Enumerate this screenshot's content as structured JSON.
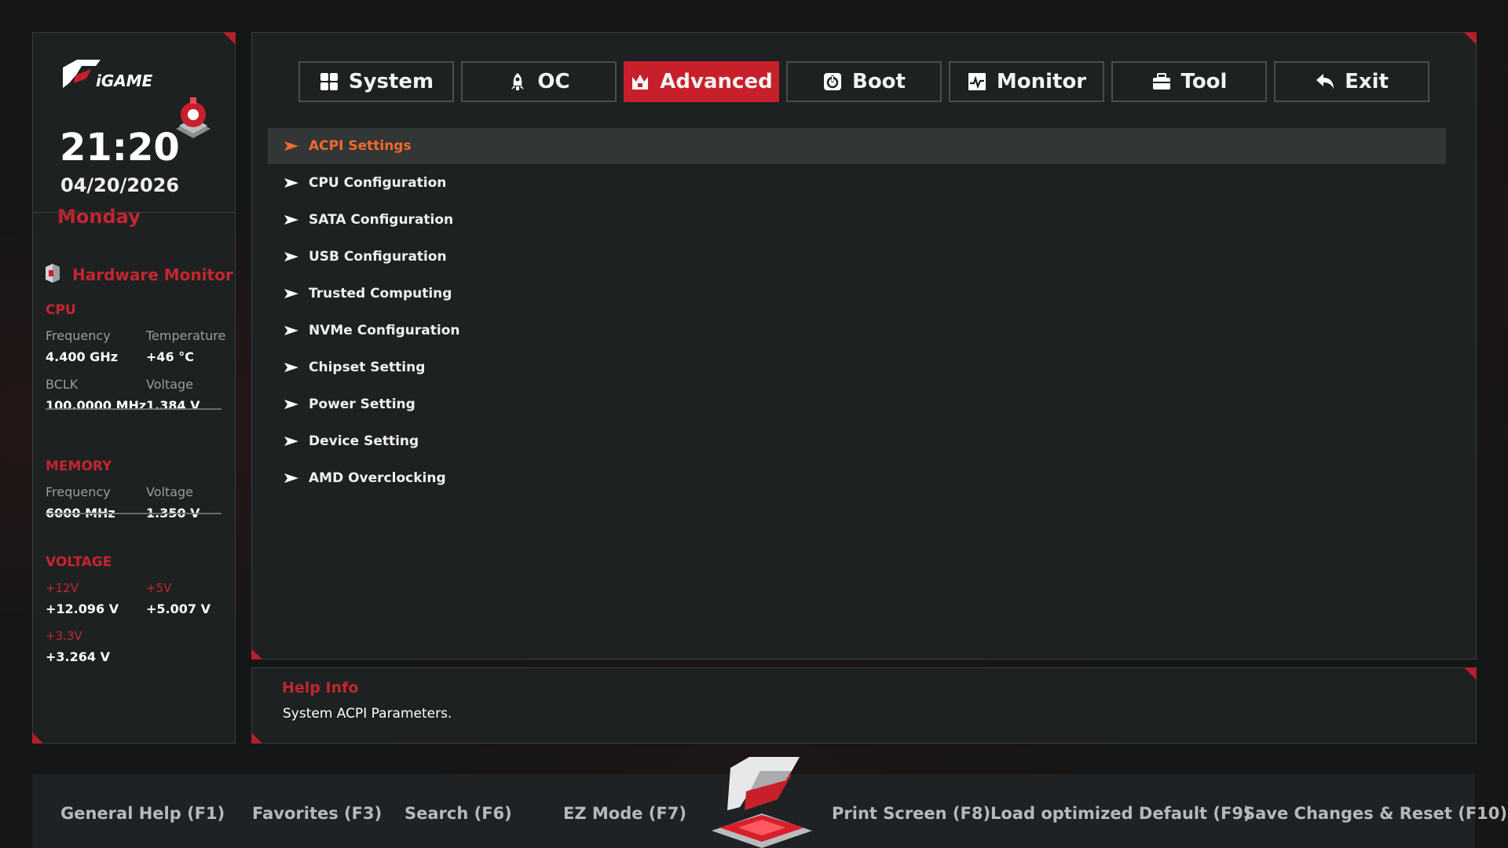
{
  "clock": {
    "time": "21:20",
    "date": "04/20/2026",
    "day": "Monday"
  },
  "hardware_monitor": {
    "title": "Hardware Monitor",
    "cpu": {
      "title": "CPU",
      "frequency_label": "Frequency",
      "frequency": "4.400 GHz",
      "temperature_label": "Temperature",
      "temperature": "+46 °C",
      "bclk_label": "BCLK",
      "bclk": "100.0000 MHz",
      "voltage_label": "Voltage",
      "voltage": "1.384 V"
    },
    "memory": {
      "title": "MEMORY",
      "frequency_label": "Frequency",
      "frequency": "6000 MHz",
      "voltage_label": "Voltage",
      "voltage": "1.350 V"
    },
    "voltage": {
      "title": "VOLTAGE",
      "v12_label": "+12V",
      "v12": "+12.096 V",
      "v5_label": "+5V",
      "v5": "+5.007 V",
      "v33_label": "+3.3V",
      "v33": "+3.264 V"
    }
  },
  "tabs": [
    {
      "label": "System",
      "icon": "grid-icon"
    },
    {
      "label": "OC",
      "icon": "rocket-icon"
    },
    {
      "label": "Advanced",
      "icon": "crown-icon",
      "active": true
    },
    {
      "label": "Boot",
      "icon": "power-icon"
    },
    {
      "label": "Monitor",
      "icon": "pulse-icon"
    },
    {
      "label": "Tool",
      "icon": "toolbox-icon"
    },
    {
      "label": "Exit",
      "icon": "return-icon"
    }
  ],
  "menu": [
    {
      "label": "ACPI Settings",
      "selected": true
    },
    {
      "label": "CPU Configuration"
    },
    {
      "label": "SATA Configuration"
    },
    {
      "label": "USB Configuration"
    },
    {
      "label": "Trusted Computing"
    },
    {
      "label": "NVMe Configuration"
    },
    {
      "label": "Chipset Setting"
    },
    {
      "label": "Power Setting"
    },
    {
      "label": "Device Setting"
    },
    {
      "label": "AMD Overclocking"
    }
  ],
  "help": {
    "title": "Help Info",
    "text": "System ACPI Parameters."
  },
  "footer": {
    "general_help": "General Help (F1)",
    "favorites": "Favorites (F3)",
    "search": "Search (F6)",
    "ez_mode": "EZ Mode (F7)",
    "print_screen": "Print Screen (F8)",
    "load_default": "Load optimized Default (F9)",
    "save_reset": "Save Changes & Reset (F10)"
  },
  "colors": {
    "accent_red": "#c8202b",
    "selected_orange": "#f26b2b",
    "panel_bg": "#1e2121"
  }
}
